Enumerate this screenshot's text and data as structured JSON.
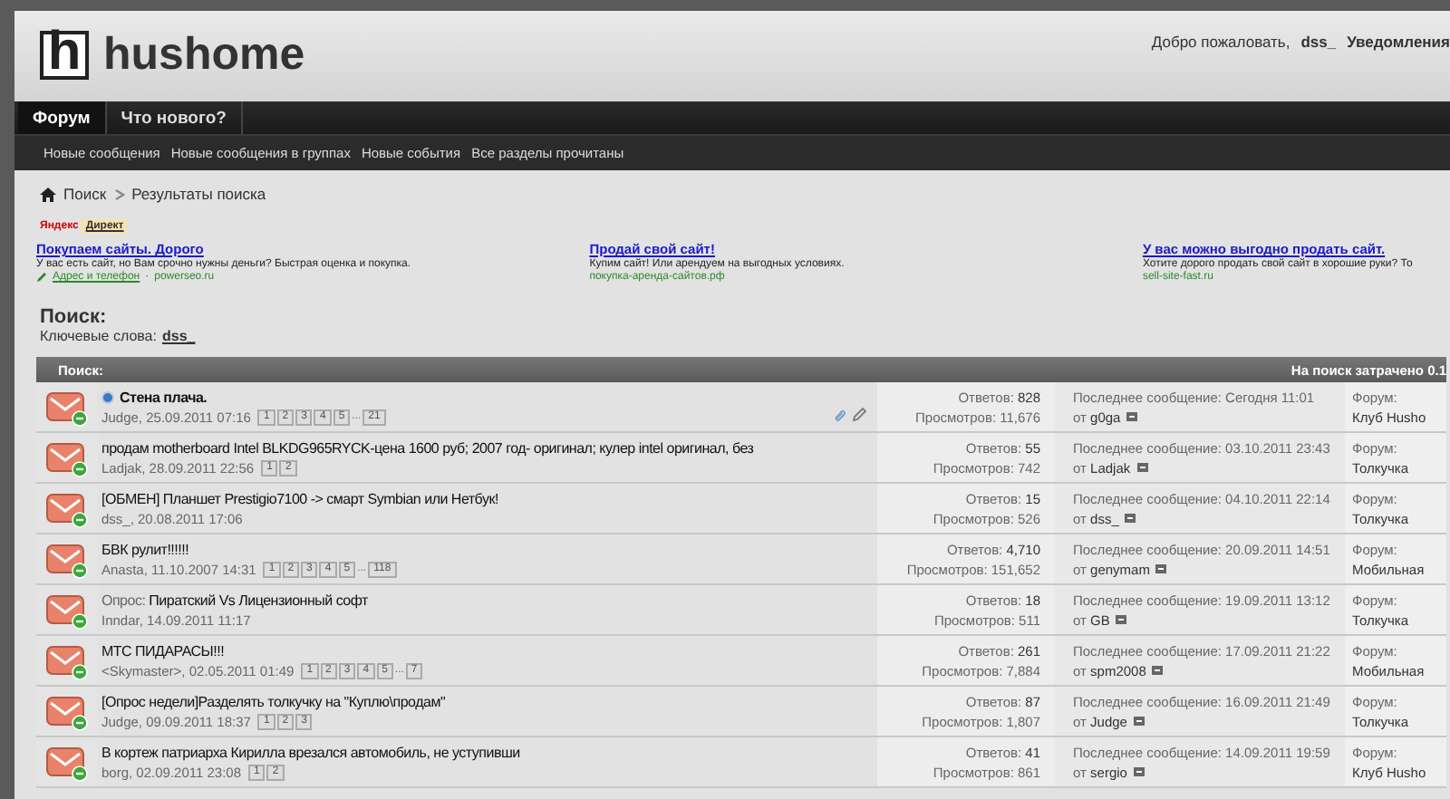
{
  "header": {
    "logo_letter": "h",
    "logo_text": "hushome",
    "welcome": "Добро пожаловать,",
    "username": "dss_",
    "notifications": "Уведомления"
  },
  "nav": {
    "tabs": [
      {
        "label": "Форум",
        "selected": true
      },
      {
        "label": "Что нового?",
        "selected": false
      }
    ],
    "links": [
      "Новые сообщения",
      "Новые сообщения в группах",
      "Новые события",
      "Все разделы прочитаны"
    ]
  },
  "breadcrumb": [
    "Поиск",
    "Результаты поиска"
  ],
  "ads": {
    "brand": "Яндекс",
    "label": "Директ",
    "items": [
      {
        "title": "Покупаем сайты. Дорого",
        "text": "У вас есть сайт, но Вам срочно нужны деньги? Быстрая оценка и покупка.",
        "contact": "Адрес и телефон",
        "separator": "·",
        "url": "powerseo.ru"
      },
      {
        "title": "Продай свой сайт!",
        "text": "Купим сайт! Или арендуем на выгодных условиях.",
        "url": "покупка-аренда-сайтов.рф"
      },
      {
        "title": "У вас можно выгодно продать сайт.",
        "text": "Хотите дорого продать свой сайт в хорошие руки? То",
        "url": "sell-site-fast.ru"
      }
    ]
  },
  "search": {
    "heading": "Поиск:",
    "keywords_label": "Ключевые слова:",
    "keywords": "dss_"
  },
  "results": {
    "title": "Поиск:",
    "time": "На поиск затрачено 0.1",
    "rows": [
      {
        "title": "Стена плача.",
        "unread": true,
        "meta": "Judge, 25.09.2011 07:16",
        "pages": [
          {
            "kind": "page",
            "label": "1"
          },
          {
            "kind": "page",
            "label": "2"
          },
          {
            "kind": "page",
            "label": "3"
          },
          {
            "kind": "page",
            "label": "4"
          },
          {
            "kind": "page",
            "label": "5"
          },
          {
            "kind": "gap",
            "label": "..."
          },
          {
            "kind": "page",
            "label": "21"
          }
        ],
        "attachments": true,
        "replies_label": "Ответов:",
        "replies": "828",
        "views_label": "Просмотров:",
        "views": "11,676",
        "last_label": "Последнее сообщение: Сегодня 11:01",
        "last_by": "от",
        "last_user": "g0ga",
        "forum_label": "Форум:",
        "forum": "Клуб Husho"
      },
      {
        "title": "продам motherboard Intel BLKDG965RYCK-цена 1600 руб; 2007 год- оригинал; кулер intel оригинал, без",
        "unread": false,
        "meta": "Ladjak, 28.09.2011 22:56",
        "pages": [
          {
            "kind": "page",
            "label": "1"
          },
          {
            "kind": "page",
            "label": "2"
          }
        ],
        "attachments": false,
        "replies_label": "Ответов:",
        "replies": "55",
        "views_label": "Просмотров:",
        "views": "742",
        "last_label": "Последнее сообщение: 03.10.2011 23:43",
        "last_by": "от",
        "last_user": "Ladjak",
        "forum_label": "Форум:",
        "forum": "Толкучка"
      },
      {
        "title": "[ОБМЕН] Планшет Prestigio7100 -> смарт Symbian или Нетбук!",
        "unread": false,
        "meta": "dss_, 20.08.2011 17:06",
        "pages": [],
        "attachments": false,
        "replies_label": "Ответов:",
        "replies": "15",
        "views_label": "Просмотров:",
        "views": "526",
        "last_label": "Последнее сообщение: 04.10.2011 22:14",
        "last_by": "от",
        "last_user": "dss_",
        "forum_label": "Форум:",
        "forum": "Толкучка"
      },
      {
        "title": "БВК рулит!!!!!!",
        "unread": false,
        "meta": "Anasta, 11.10.2007 14:31",
        "pages": [
          {
            "kind": "page",
            "label": "1"
          },
          {
            "kind": "page",
            "label": "2"
          },
          {
            "kind": "page",
            "label": "3"
          },
          {
            "kind": "page",
            "label": "4"
          },
          {
            "kind": "page",
            "label": "5"
          },
          {
            "kind": "gap",
            "label": "..."
          },
          {
            "kind": "page",
            "label": "118"
          }
        ],
        "attachments": false,
        "replies_label": "Ответов:",
        "replies": "4,710",
        "views_label": "Просмотров:",
        "views": "151,652",
        "last_label": "Последнее сообщение: 20.09.2011 14:51",
        "last_by": "от",
        "last_user": "genymam",
        "forum_label": "Форум:",
        "forum": "Мобильная"
      },
      {
        "prefix": "Опрос:",
        "title": "Пиратский Vs Лицензионный софт",
        "unread": false,
        "meta": "Inndar, 14.09.2011 11:17",
        "pages": [],
        "attachments": false,
        "replies_label": "Ответов:",
        "replies": "18",
        "views_label": "Просмотров:",
        "views": "511",
        "last_label": "Последнее сообщение: 19.09.2011 13:12",
        "last_by": "от",
        "last_user": "GB",
        "forum_label": "Форум:",
        "forum": "Толкучка"
      },
      {
        "title": "МТС ПИДАРАСЫ!!!",
        "unread": false,
        "meta": "<Skymaster>, 02.05.2011 01:49",
        "pages": [
          {
            "kind": "page",
            "label": "1"
          },
          {
            "kind": "page",
            "label": "2"
          },
          {
            "kind": "page",
            "label": "3"
          },
          {
            "kind": "page",
            "label": "4"
          },
          {
            "kind": "page",
            "label": "5"
          },
          {
            "kind": "gap",
            "label": "..."
          },
          {
            "kind": "page",
            "label": "7"
          }
        ],
        "attachments": false,
        "replies_label": "Ответов:",
        "replies": "261",
        "views_label": "Просмотров:",
        "views": "7,884",
        "last_label": "Последнее сообщение: 17.09.2011 21:22",
        "last_by": "от",
        "last_user": "spm2008",
        "forum_label": "Форум:",
        "forum": "Мобильная"
      },
      {
        "title": "[Опрос недели]Разделять толкучку на \"Куплю\\продам\"",
        "unread": false,
        "meta": "Judge, 09.09.2011 18:37",
        "pages": [
          {
            "kind": "page",
            "label": "1"
          },
          {
            "kind": "page",
            "label": "2"
          },
          {
            "kind": "page",
            "label": "3"
          }
        ],
        "attachments": false,
        "replies_label": "Ответов:",
        "replies": "87",
        "views_label": "Просмотров:",
        "views": "1,807",
        "last_label": "Последнее сообщение: 16.09.2011 21:49",
        "last_by": "от",
        "last_user": "Judge",
        "forum_label": "Форум:",
        "forum": "Толкучка"
      },
      {
        "title": "В кортеж патриарха Кирилла врезался автомобиль, не уступивши",
        "unread": false,
        "meta": "borg, 02.09.2011 23:08",
        "pages": [
          {
            "kind": "page",
            "label": "1"
          },
          {
            "kind": "page",
            "label": "2"
          }
        ],
        "attachments": false,
        "replies_label": "Ответов:",
        "replies": "41",
        "views_label": "Просмотров:",
        "views": "861",
        "last_label": "Последнее сообщение: 14.09.2011 19:59",
        "last_by": "от",
        "last_user": "sergio",
        "forum_label": "Форум:",
        "forum": "Клуб Husho"
      }
    ]
  }
}
